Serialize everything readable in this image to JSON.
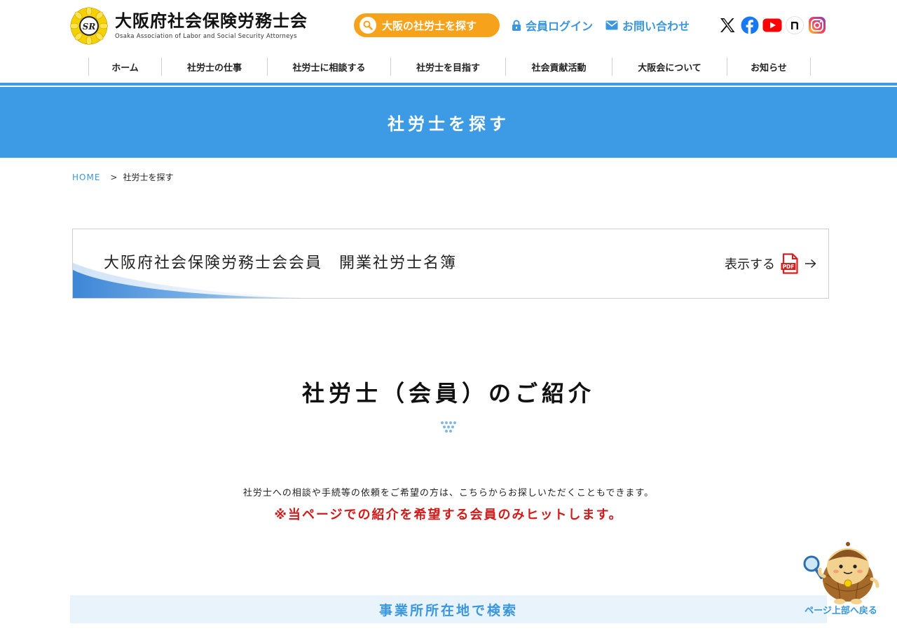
{
  "header": {
    "logo_jp": "大阪府社会保険労務士会",
    "logo_en": "Osaka Association of Labor and Social Security Attorneys",
    "search_button": "大阪の社労士を探す",
    "login": "会員ログイン",
    "contact": "お問い合わせ",
    "sns": [
      "x-icon",
      "facebook-icon",
      "youtube-icon",
      "note-icon",
      "instagram-icon"
    ]
  },
  "nav": {
    "items": [
      {
        "label": "ホーム"
      },
      {
        "label": "社労士の仕事"
      },
      {
        "label": "社労士に相談する"
      },
      {
        "label": "社労士を目指す"
      },
      {
        "label": "社会貢献活動"
      },
      {
        "label": "大阪会について"
      },
      {
        "label": "お知らせ"
      }
    ]
  },
  "page": {
    "title": "社労士を探す"
  },
  "breadcrumb": {
    "home": "HOME",
    "separator": ">",
    "current": "社労士を探す"
  },
  "roster": {
    "title": "大阪府社会保険労務士会会員　開業社労士名簿",
    "show": "表示する",
    "pdf_label": "PDF"
  },
  "intro": {
    "title": "社労士（会員）のご紹介",
    "text": "社労士への相談や手続等の依頼をご希望の方は、こちらからお探しいただくこともできます。",
    "note": "※当ページでの紹介を希望する会員のみヒットします。"
  },
  "search_section": {
    "title": "事業所所在地で検索"
  },
  "pagetop": {
    "label": "ページ上部へ戻る"
  },
  "colors": {
    "brand_blue": "#3d9be5",
    "accent_orange": "#f6a21a",
    "note_red": "#d11a1a"
  }
}
